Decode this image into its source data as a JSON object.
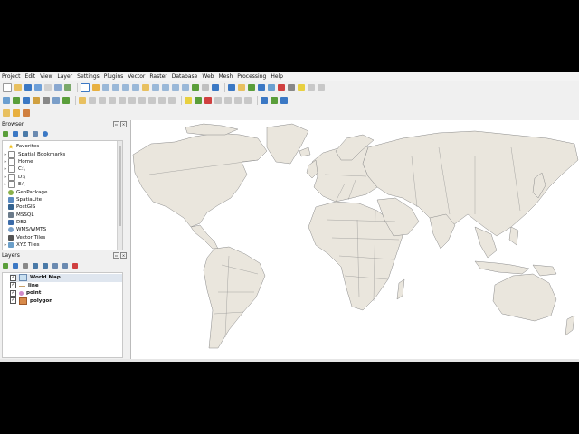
{
  "menu": [
    "Project",
    "Edit",
    "View",
    "Layer",
    "Settings",
    "Plugins",
    "Vector",
    "Raster",
    "Database",
    "Web",
    "Mesh",
    "Processing",
    "Help"
  ],
  "browser": {
    "title": "Browser",
    "items": [
      {
        "label": "Favorites",
        "icon": "star-icon",
        "arrow": ""
      },
      {
        "label": "Spatial Bookmarks",
        "icon": "bookmark-icon",
        "arrow": "▸"
      },
      {
        "label": "Home",
        "icon": "folder-icon",
        "arrow": "▸"
      },
      {
        "label": "C:\\",
        "icon": "drive-icon",
        "arrow": "▸"
      },
      {
        "label": "D:\\",
        "icon": "drive-icon",
        "arrow": "▸"
      },
      {
        "label": "E:\\",
        "icon": "drive-icon",
        "arrow": "▸"
      },
      {
        "label": "GeoPackage",
        "icon": "geopackage-icon",
        "arrow": ""
      },
      {
        "label": "SpatiaLite",
        "icon": "spatialite-icon",
        "arrow": ""
      },
      {
        "label": "PostGIS",
        "icon": "postgis-icon",
        "arrow": ""
      },
      {
        "label": "MSSQL",
        "icon": "mssql-icon",
        "arrow": ""
      },
      {
        "label": "DB2",
        "icon": "db2-icon",
        "arrow": ""
      },
      {
        "label": "WMS/WMTS",
        "icon": "wms-icon",
        "arrow": ""
      },
      {
        "label": "Vector Tiles",
        "icon": "vector-tiles-icon",
        "arrow": ""
      },
      {
        "label": "XYZ Tiles",
        "icon": "xyz-tiles-icon",
        "arrow": "▸"
      }
    ]
  },
  "layers": {
    "title": "Layers",
    "items": [
      {
        "label": "World Map",
        "checked": "✓",
        "sym": "polygon"
      },
      {
        "label": "line",
        "checked": "✓",
        "sym": "line"
      },
      {
        "label": "point",
        "checked": "✓",
        "sym": "point"
      },
      {
        "label": "polygon",
        "checked": "✓",
        "sym": "fill"
      }
    ]
  },
  "colors": {
    "land": "#eae6dd",
    "border": "#8a8a8a",
    "accent": "#3b78c4",
    "qgis_green": "#5a9e3a",
    "star": "#f0c020"
  }
}
